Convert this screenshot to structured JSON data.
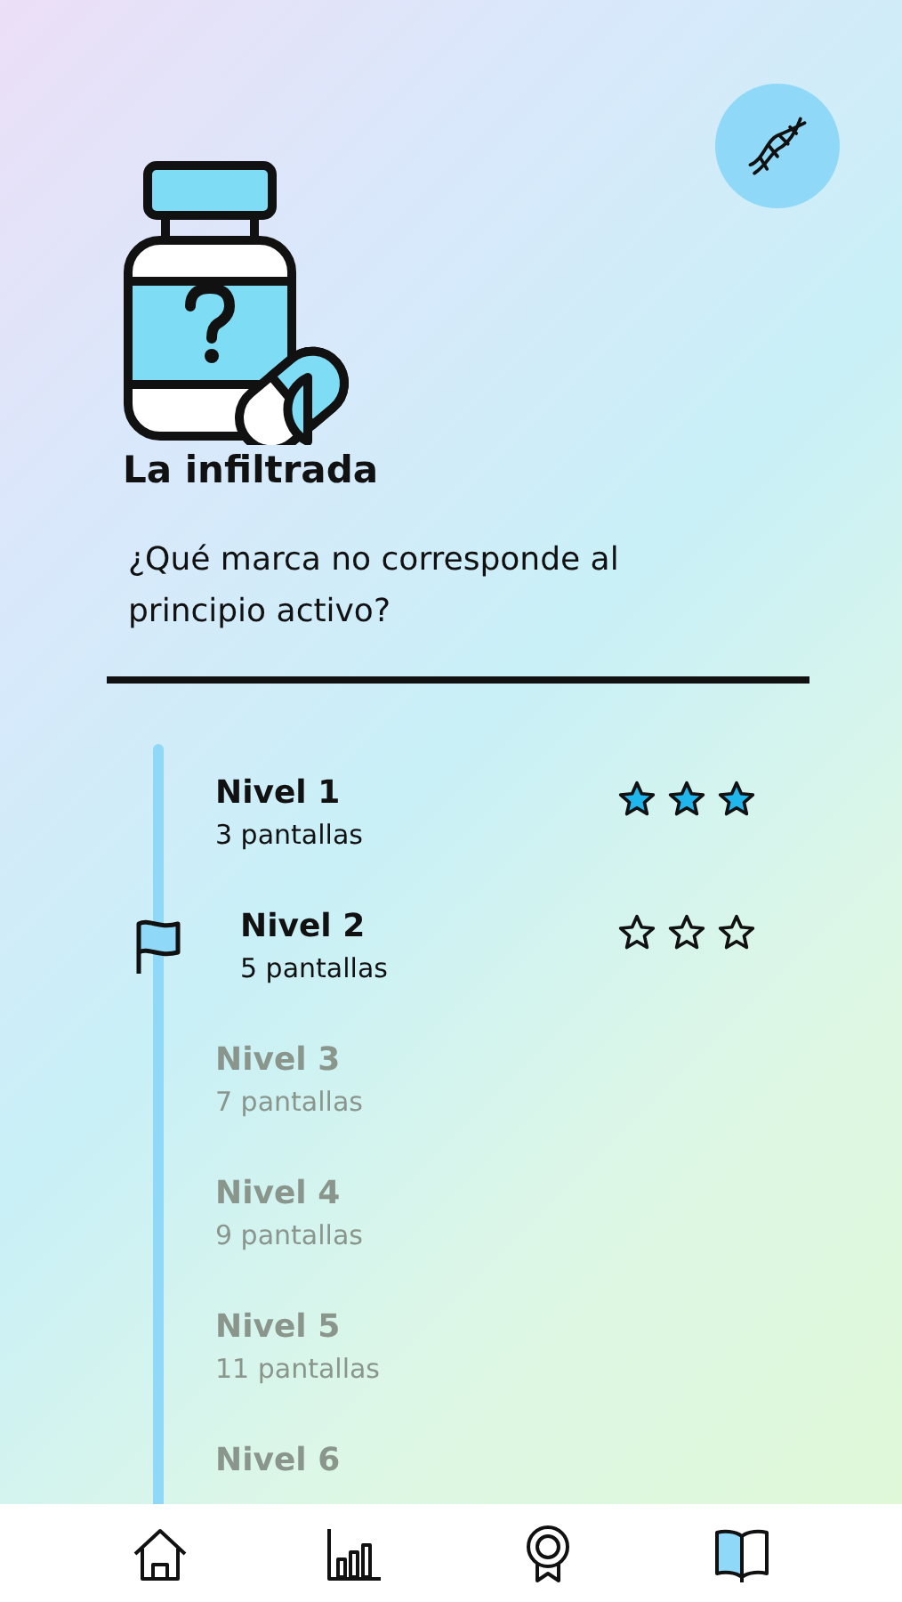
{
  "header": {
    "title": "La infiltrada",
    "question": "¿Qué marca no corresponde al principio activo?"
  },
  "levels": [
    {
      "title": "Nivel 1",
      "subtitle": "3 pantallas",
      "locked": false,
      "current": false,
      "stars": 3
    },
    {
      "title": "Nivel 2",
      "subtitle": "5 pantallas",
      "locked": false,
      "current": true,
      "stars": 0
    },
    {
      "title": "Nivel 3",
      "subtitle": "7 pantallas",
      "locked": true,
      "current": false
    },
    {
      "title": "Nivel 4",
      "subtitle": "9 pantallas",
      "locked": true,
      "current": false
    },
    {
      "title": "Nivel 5",
      "subtitle": "11 pantallas",
      "locked": true,
      "current": false
    },
    {
      "title": "Nivel 6",
      "locked": true,
      "current": false
    }
  ],
  "nav": [
    {
      "kind": "home",
      "selected": false
    },
    {
      "kind": "stats",
      "selected": false
    },
    {
      "kind": "award",
      "selected": false
    },
    {
      "kind": "book",
      "selected": true
    }
  ]
}
